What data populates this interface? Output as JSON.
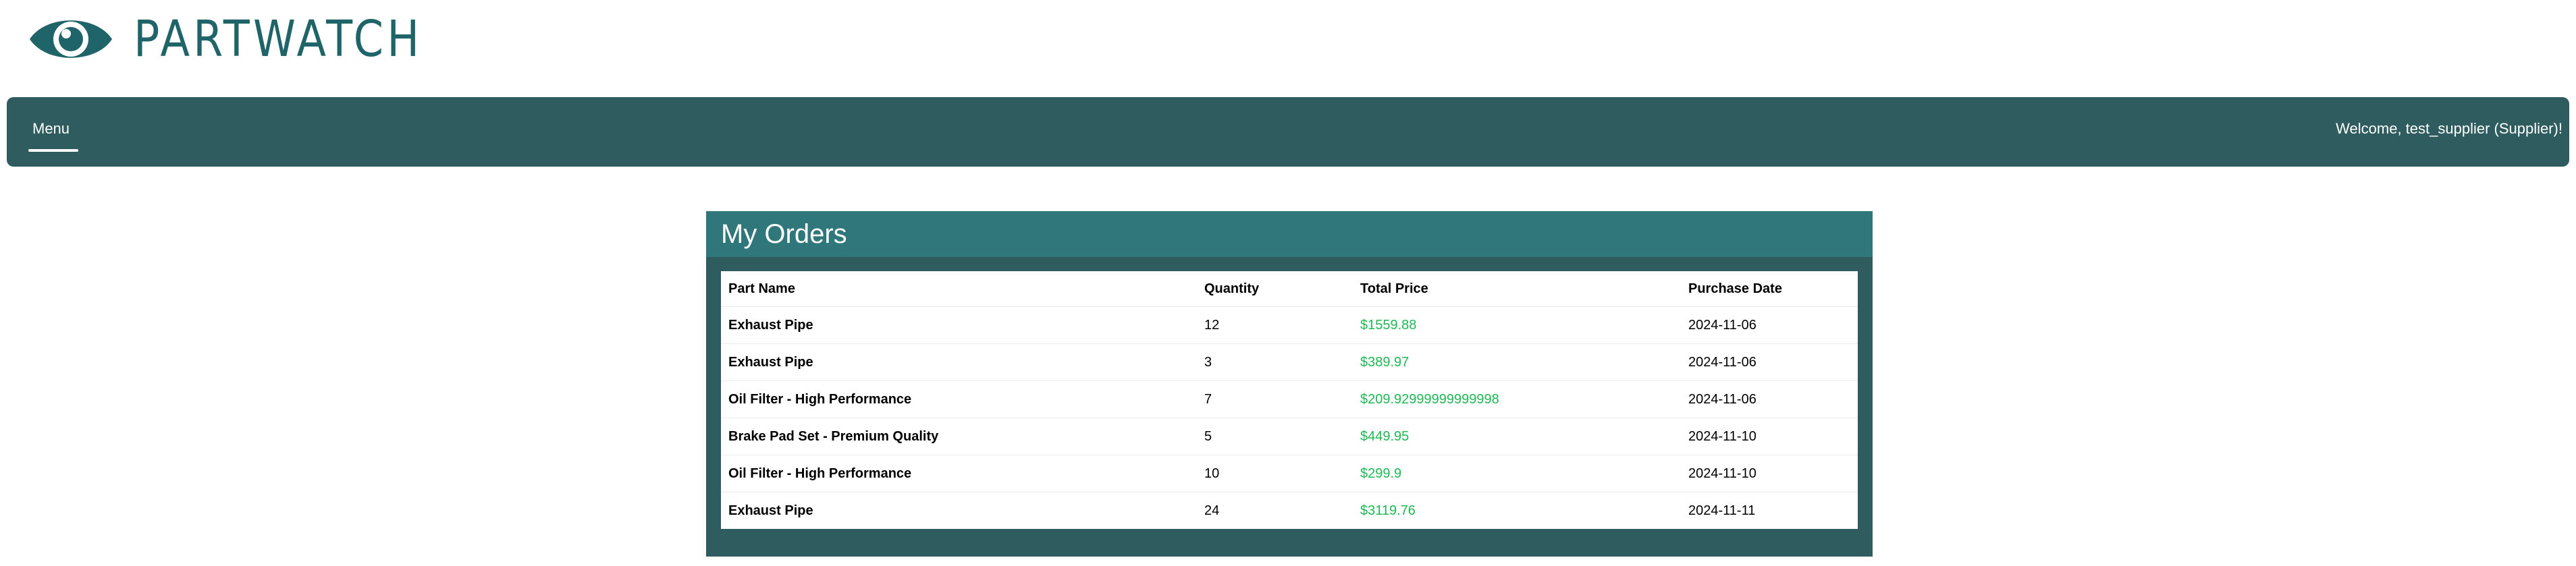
{
  "brand": {
    "name": "PARTWATCH",
    "logo_icon": "eye-icon",
    "color": "#1f6468"
  },
  "navbar": {
    "menu_label": "Menu",
    "welcome_text": "Welcome, test_supplier (Supplier)!",
    "background": "#2f5d5f"
  },
  "orders": {
    "title": "My Orders",
    "columns": [
      "Part Name",
      "Quantity",
      "Total Price",
      "Purchase Date"
    ],
    "rows": [
      {
        "part": "Exhaust Pipe",
        "quantity": "12",
        "price": "$1559.88",
        "date": "2024-11-06"
      },
      {
        "part": "Exhaust Pipe",
        "quantity": "3",
        "price": "$389.97",
        "date": "2024-11-06"
      },
      {
        "part": "Oil Filter - High Performance",
        "quantity": "7",
        "price": "$209.92999999999998",
        "date": "2024-11-06"
      },
      {
        "part": "Brake Pad Set - Premium Quality",
        "quantity": "5",
        "price": "$449.95",
        "date": "2024-11-10"
      },
      {
        "part": "Oil Filter - High Performance",
        "quantity": "10",
        "price": "$299.9",
        "date": "2024-11-10"
      },
      {
        "part": "Exhaust Pipe",
        "quantity": "24",
        "price": "$3119.76",
        "date": "2024-11-11"
      }
    ],
    "price_color": "#1db954",
    "header_color": "#2f777a"
  }
}
